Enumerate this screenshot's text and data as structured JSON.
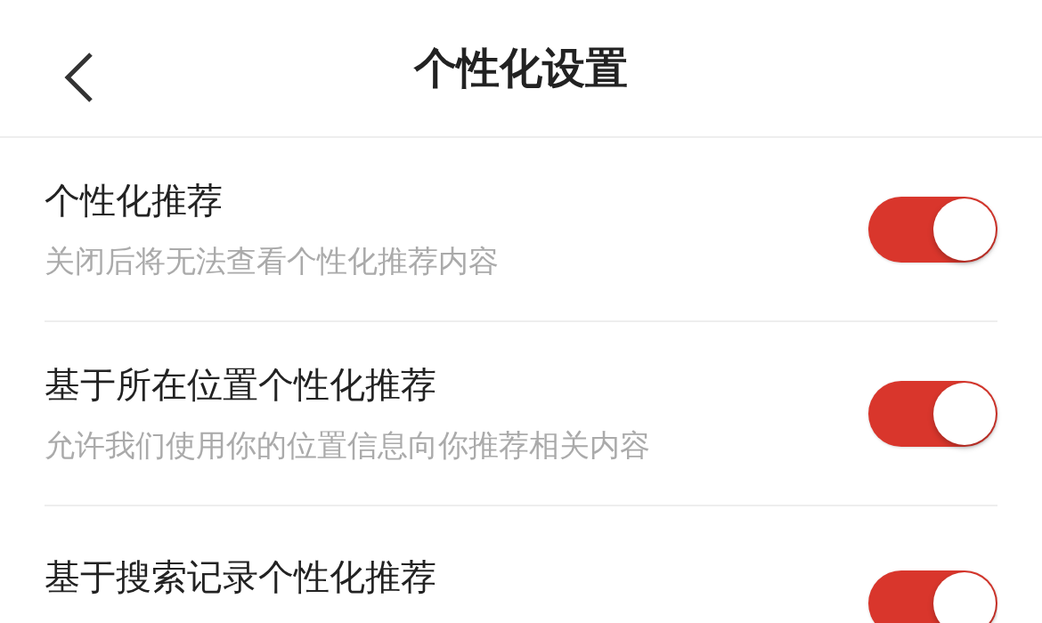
{
  "header": {
    "title": "个性化设置"
  },
  "settings": [
    {
      "title": "个性化推荐",
      "description": "关闭后将无法查看个性化推荐内容",
      "on": true
    },
    {
      "title": "基于所在位置个性化推荐",
      "description": "允许我们使用你的位置信息向你推荐相关内容",
      "on": true
    },
    {
      "title": "基于搜索记录个性化推荐",
      "on": true
    }
  ]
}
